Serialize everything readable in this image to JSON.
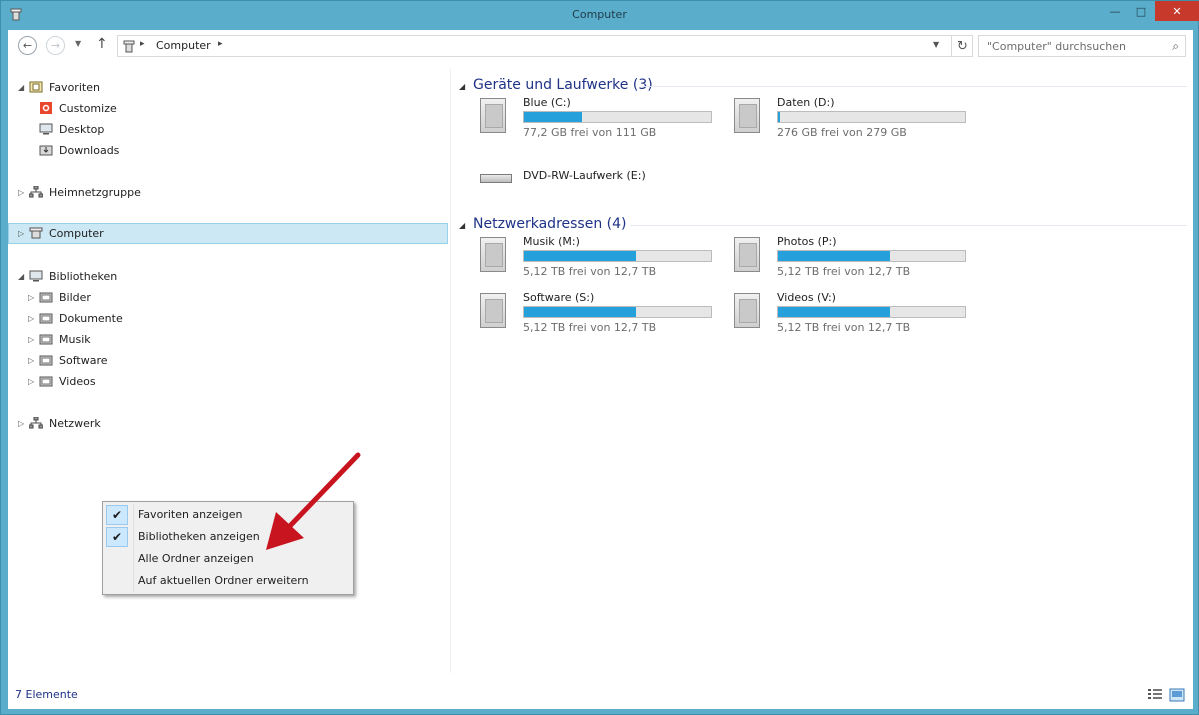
{
  "window": {
    "title": "Computer",
    "close_glyph": "✕",
    "min_glyph": "—",
    "max_glyph": "□"
  },
  "nav": {
    "back_glyph": "←",
    "forward_glyph": "→",
    "up_glyph": "↑",
    "dropdown_glyph": "▼",
    "refresh_glyph": "↻"
  },
  "address": {
    "path": "Computer",
    "sep_glyph": "▸"
  },
  "search": {
    "placeholder": "\"Computer\" durchsuchen",
    "icon_glyph": "⌕"
  },
  "sidebar": {
    "favorites": {
      "label": "Favoriten",
      "items": [
        "Customize",
        "Desktop",
        "Downloads"
      ]
    },
    "homegroup": "Heimnetzgruppe",
    "computer": "Computer",
    "libraries": {
      "label": "Bibliotheken",
      "items": [
        "Bilder",
        "Dokumente",
        "Musik",
        "Software",
        "Videos"
      ]
    },
    "network": "Netzwerk"
  },
  "groups": {
    "devices": {
      "title": "Geräte und Laufwerke (3)",
      "drives": [
        {
          "name": "Blue (C:)",
          "free": "77,2 GB frei von 111 GB",
          "used_fraction": 0.31
        },
        {
          "name": "Daten (D:)",
          "free": "276 GB frei von 279 GB",
          "used_fraction": 0.01
        }
      ],
      "dvd": {
        "name": "DVD-RW-Laufwerk (E:)"
      }
    },
    "network": {
      "title": "Netzwerkadressen (4)",
      "drives": [
        {
          "name": "Musik (M:)",
          "free": "5,12 TB frei von 12,7 TB",
          "used_fraction": 0.6
        },
        {
          "name": "Photos (P:)",
          "free": "5,12 TB frei von 12,7 TB",
          "used_fraction": 0.6
        },
        {
          "name": "Software (S:)",
          "free": "5,12 TB frei von 12,7 TB",
          "used_fraction": 0.6
        },
        {
          "name": "Videos (V:)",
          "free": "5,12 TB frei von 12,7 TB",
          "used_fraction": 0.6
        }
      ]
    }
  },
  "context_menu": {
    "items": [
      {
        "label": "Favoriten anzeigen",
        "checked": true
      },
      {
        "label": "Bibliotheken anzeigen",
        "checked": true
      },
      {
        "label": "Alle Ordner anzeigen",
        "checked": false
      },
      {
        "label": "Auf aktuellen Ordner erweitern",
        "checked": false
      }
    ],
    "check_glyph": "✔"
  },
  "status": {
    "count": "7 Elemente"
  },
  "colors": {
    "accent": "#26a0da",
    "title_frame": "#5aaecb",
    "group_header": "#1e3287",
    "selection": "#cce8f4",
    "annotation_arrow": "#c8141e"
  }
}
